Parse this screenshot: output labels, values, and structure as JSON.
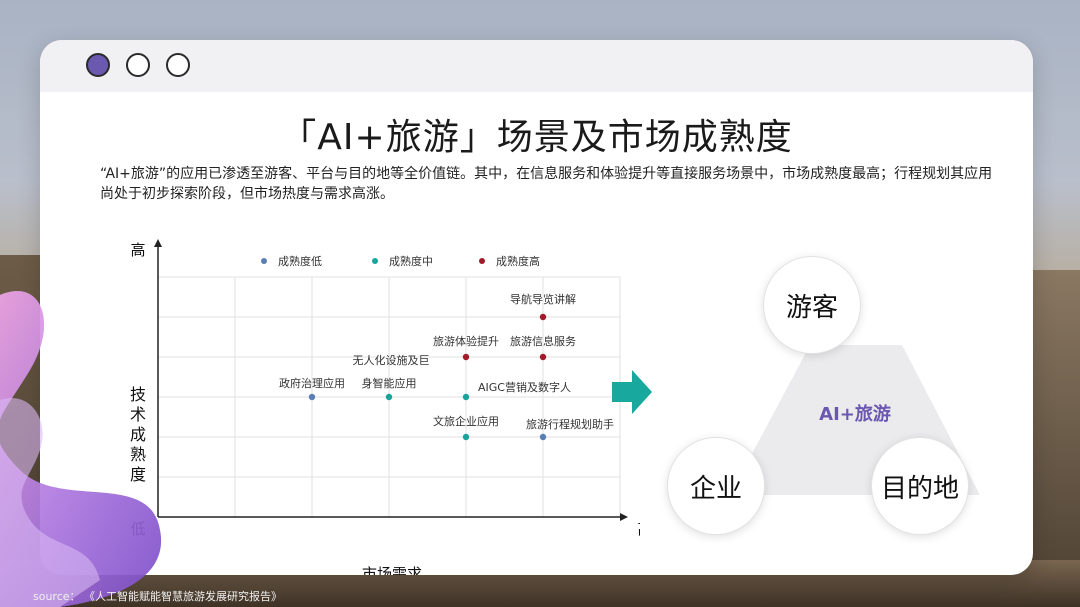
{
  "title": "「AI+旅游」场景及市场成熟度",
  "description": "“AI+旅游”的应用已渗透至游客、平台与目的地等全价值链。其中，在信息服务和体验提升等直接服务场景中，市场成熟度最高；行程规划其应用尚处于初步探索阶段，但市场热度与需求高涨。",
  "window_dots": [
    "purple",
    "white",
    "white"
  ],
  "chart_data": {
    "type": "scatter",
    "xlabel": "市场需求",
    "ylabel": "技术成熟度",
    "axis_low": "低",
    "y_high": "高",
    "x_high": "高",
    "grid": true,
    "legend": [
      {
        "name": "成熟度低",
        "color": "#5b7fb5"
      },
      {
        "name": "成熟度中",
        "color": "#1aa39a"
      },
      {
        "name": "成熟度高",
        "color": "#a01a2a"
      }
    ],
    "points": [
      {
        "label": "导航导览讲解",
        "x": 5,
        "y": 5,
        "level": 2
      },
      {
        "label": "旅游体验提升",
        "x": 4,
        "y": 4,
        "level": 2
      },
      {
        "label": "旅游信息服务",
        "x": 5,
        "y": 4,
        "level": 2
      },
      {
        "label": "无人化设施及巨身智能应用",
        "x": 3,
        "y": 3,
        "level": 1
      },
      {
        "label": "政府治理应用",
        "x": 2,
        "y": 3,
        "level": 0
      },
      {
        "label": "AIGC营销及数字人",
        "x": 4,
        "y": 3,
        "level": 1
      },
      {
        "label": "文旅企业应用",
        "x": 4,
        "y": 2,
        "level": 1
      },
      {
        "label": "旅游行程规划助手",
        "x": 5,
        "y": 2,
        "level": 0
      }
    ]
  },
  "diagram": {
    "center": "AI+旅游",
    "nodes": [
      "游客",
      "企业",
      "目的地"
    ]
  },
  "source": "source： 《人工智能赋能智慧旅游发展研究报告》"
}
